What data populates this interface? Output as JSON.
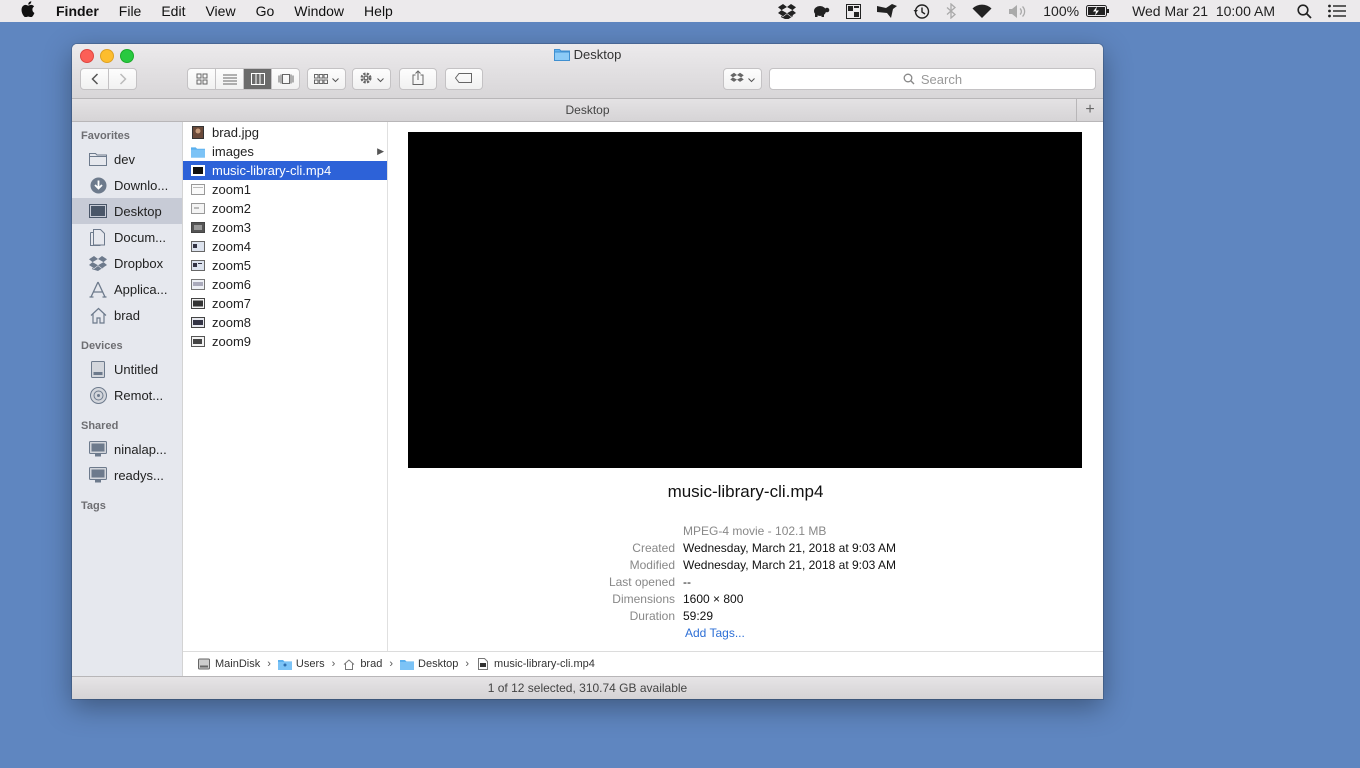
{
  "menubar": {
    "app_name": "Finder",
    "items": [
      "File",
      "Edit",
      "View",
      "Go",
      "Window",
      "Help"
    ],
    "battery": "100%",
    "datetime": "Wed Mar 21  10:00 AM"
  },
  "window": {
    "title": "Desktop",
    "path_title": "Desktop",
    "search_placeholder": "Search"
  },
  "sidebar": {
    "favorites_heading": "Favorites",
    "favorites": [
      {
        "label": "dev",
        "icon": "folder-icon"
      },
      {
        "label": "Downlo...",
        "icon": "downloads-icon"
      },
      {
        "label": "Desktop",
        "icon": "desktop-icon"
      },
      {
        "label": "Docum...",
        "icon": "documents-icon"
      },
      {
        "label": "Dropbox",
        "icon": "dropbox-icon"
      },
      {
        "label": "Applica...",
        "icon": "applications-icon"
      },
      {
        "label": "brad",
        "icon": "home-icon"
      }
    ],
    "devices_heading": "Devices",
    "devices": [
      {
        "label": "Untitled",
        "icon": "disk-icon"
      },
      {
        "label": "Remot...",
        "icon": "remote-disc-icon"
      }
    ],
    "shared_heading": "Shared",
    "shared": [
      {
        "label": "ninalap...",
        "icon": "computer-icon"
      },
      {
        "label": "readys...",
        "icon": "computer-icon"
      }
    ],
    "tags_heading": "Tags"
  },
  "files": [
    {
      "name": "brad.jpg"
    },
    {
      "name": "images"
    },
    {
      "name": "music-library-cli.mp4"
    },
    {
      "name": "zoom1"
    },
    {
      "name": "zoom2"
    },
    {
      "name": "zoom3"
    },
    {
      "name": "zoom4"
    },
    {
      "name": "zoom5"
    },
    {
      "name": "zoom6"
    },
    {
      "name": "zoom7"
    },
    {
      "name": "zoom8"
    },
    {
      "name": "zoom9"
    }
  ],
  "preview": {
    "name": "music-library-cli.mp4",
    "kind": "MPEG-4 movie - 102.1 MB",
    "meta": [
      {
        "key": "Created",
        "value": "Wednesday, March 21, 2018 at 9:03 AM"
      },
      {
        "key": "Modified",
        "value": "Wednesday, March 21, 2018 at 9:03 AM"
      },
      {
        "key": "Last opened",
        "value": "--"
      },
      {
        "key": "Dimensions",
        "value": "1600 × 800"
      },
      {
        "key": "Duration",
        "value": "59:29"
      }
    ],
    "add_tags": "Add Tags..."
  },
  "breadcrumbs": [
    "MainDisk",
    "Users",
    "brad",
    "Desktop",
    "music-library-cli.mp4"
  ],
  "status": "1 of 12 selected, 310.74 GB available",
  "colors": {
    "desktop": "#5f86c0",
    "selection": "#2d62d8",
    "sidebar_selection": "#c7cbd6",
    "link": "#2d6fd6"
  }
}
